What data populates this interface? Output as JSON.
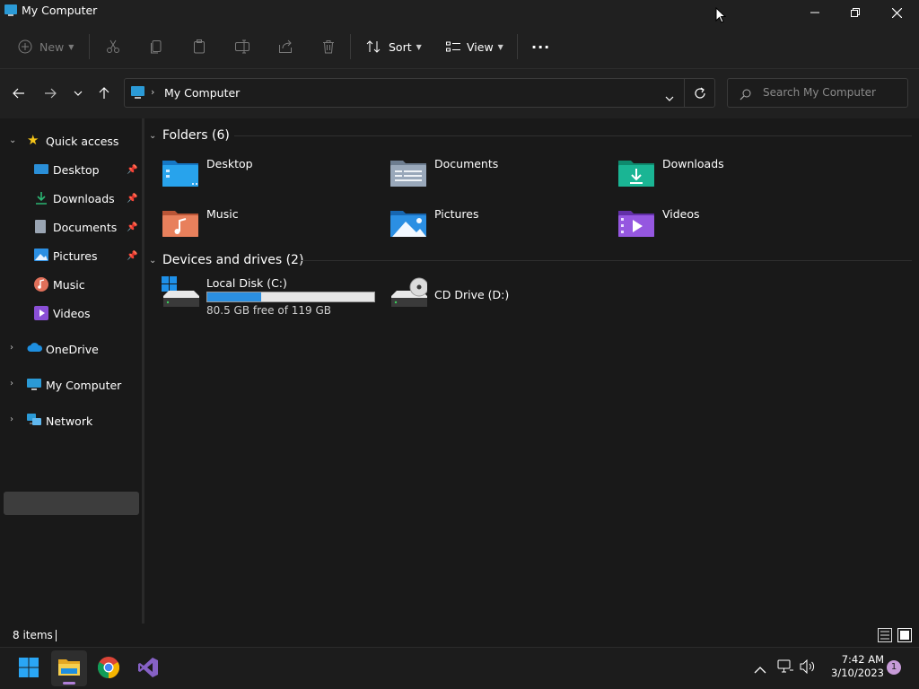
{
  "window": {
    "title": "My Computer"
  },
  "toolbar": {
    "new_label": "New",
    "sort_label": "Sort",
    "view_label": "View",
    "more_label": "···"
  },
  "address": {
    "location": "My Computer",
    "search_placeholder": "Search My Computer"
  },
  "sidebar": {
    "quick_access": "Quick access",
    "items": [
      {
        "label": "Desktop",
        "icon": "desktop-icon",
        "pinned": true
      },
      {
        "label": "Downloads",
        "icon": "downloads-icon",
        "pinned": true
      },
      {
        "label": "Documents",
        "icon": "documents-icon",
        "pinned": true
      },
      {
        "label": "Pictures",
        "icon": "pictures-icon",
        "pinned": true
      },
      {
        "label": "Music",
        "icon": "music-icon",
        "pinned": false
      },
      {
        "label": "Videos",
        "icon": "videos-icon",
        "pinned": false
      }
    ],
    "onedrive": "OneDrive",
    "my_computer": "My Computer",
    "network": "Network"
  },
  "main": {
    "folders_header": "Folders (6)",
    "folders": [
      {
        "label": "Desktop",
        "icon": "desktop-folder-icon",
        "color": "#1e8fe0"
      },
      {
        "label": "Documents",
        "icon": "documents-folder-icon",
        "color": "#8a9bb0"
      },
      {
        "label": "Downloads",
        "icon": "downloads-folder-icon",
        "color": "#1aa58a"
      },
      {
        "label": "Music",
        "icon": "music-folder-icon",
        "color": "#e07a55"
      },
      {
        "label": "Pictures",
        "icon": "pictures-folder-icon",
        "color": "#2b8fe3"
      },
      {
        "label": "Videos",
        "icon": "videos-folder-icon",
        "color": "#8a4fd6"
      }
    ],
    "devices_header": "Devices and drives (2)",
    "drives": [
      {
        "label": "Local Disk (C:)",
        "free_text": "80.5 GB free of 119 GB",
        "used_fraction": 0.324,
        "icon": "windows-drive-icon"
      },
      {
        "label": "CD Drive (D:)",
        "icon": "cd-drive-icon"
      }
    ]
  },
  "status": {
    "items": "8 items"
  },
  "taskbar": {
    "time": "7:42 AM",
    "date": "3/10/2023",
    "notification_count": "1"
  },
  "colors": {
    "accent": "#0078d4",
    "selection": "#3d3d3d",
    "background": "#191919"
  }
}
